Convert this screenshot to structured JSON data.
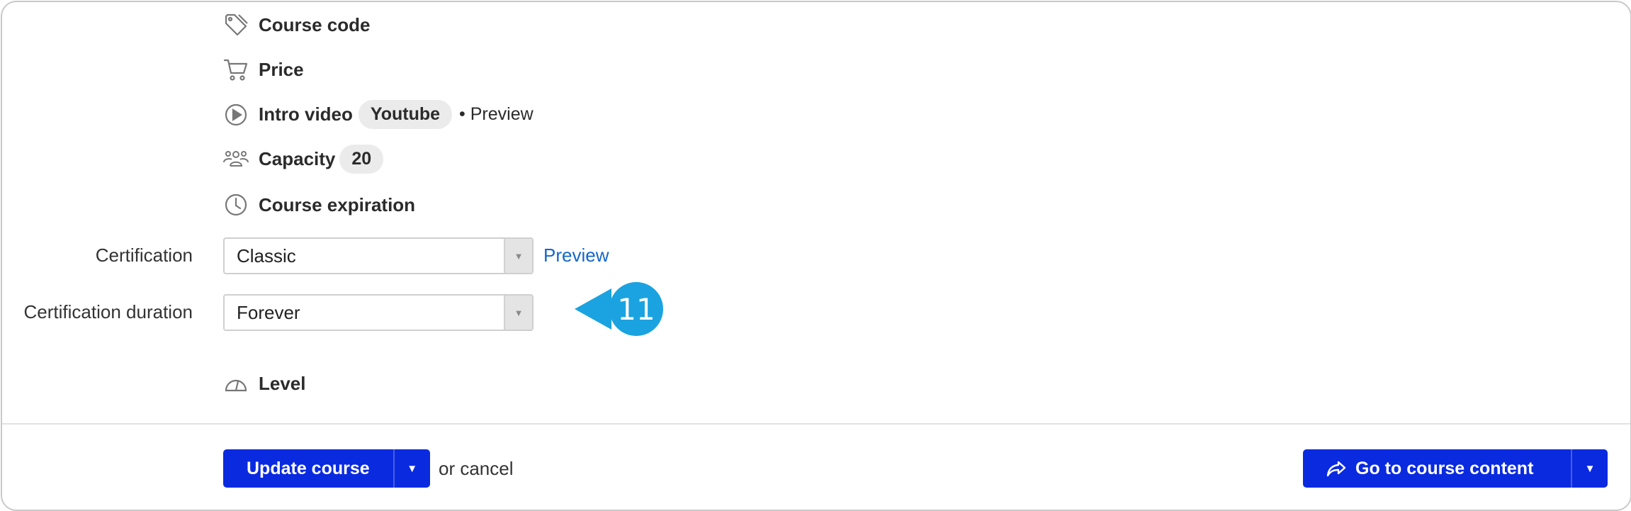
{
  "options": {
    "course_code": "Course code",
    "price": "Price",
    "intro_video": "Intro video",
    "intro_video_source": "Youtube",
    "intro_video_separator": "• Preview",
    "capacity": "Capacity",
    "capacity_value": "20",
    "course_expiration": "Course expiration",
    "level": "Level"
  },
  "certification": {
    "label": "Certification",
    "value": "Classic",
    "preview_link": "Preview"
  },
  "certification_duration": {
    "label": "Certification duration",
    "value": "Forever"
  },
  "callout": {
    "number": "11",
    "color": "#1aa3e0"
  },
  "footer": {
    "update_button": "Update course",
    "or_cancel": "or cancel",
    "go_to_content_button": "Go to course content"
  },
  "colors": {
    "primary": "#0a2ae0",
    "link": "#1466c9"
  }
}
